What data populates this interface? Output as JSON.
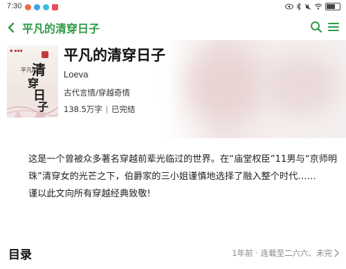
{
  "status_bar": {
    "time": "7:30",
    "icon_colors": [
      "#f26b43",
      "#3ba4f0",
      "#3cc0d6",
      "#e84d63"
    ]
  },
  "nav": {
    "back_icon": "chevron-left-icon",
    "title": "平凡的清穿日子",
    "search_icon": "search-icon",
    "menu_icon": "menu-icon",
    "accent_color": "#2e9a44"
  },
  "book": {
    "title": "平凡的清穿日子",
    "author": "Loeva",
    "genre": "古代言情/穿越奇情",
    "word_count": "138.5万字",
    "status": "已完结"
  },
  "description": {
    "paragraph1": "这是一个曾被众多著名穿越前辈光临过的世界。在“庙堂权臣”11男与“京师明珠”清穿女的光芒之下，伯爵家的三小姐谨慎地选择了融入整个时代……",
    "paragraph2": "谨以此文向所有穿越经典致敬!"
  },
  "toc": {
    "label": "目录",
    "info": "1年前 · 连载至二六六、未完"
  }
}
